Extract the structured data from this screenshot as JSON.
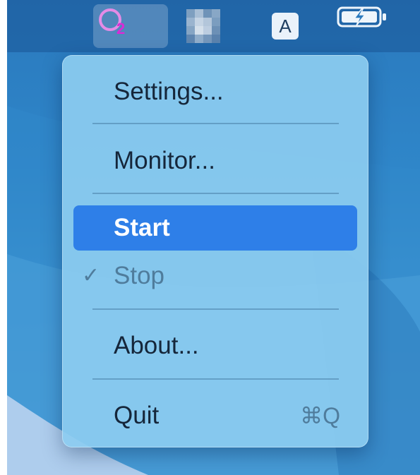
{
  "menubar": {
    "app_icon": "o2-app-icon",
    "app_icon_glyph": "O",
    "app_icon_subscript": "2",
    "blurred_icon": "pixelated-icon",
    "input_source_label": "A",
    "battery_icon": "battery-charging-icon",
    "colors": {
      "app_o": "#e58be6",
      "app_two": "#d92ad6"
    }
  },
  "menu": {
    "items": [
      {
        "label": "Settings...",
        "state": "normal"
      },
      {
        "label": "Monitor...",
        "state": "normal"
      },
      {
        "label": "Start",
        "state": "highlighted"
      },
      {
        "label": "Stop",
        "state": "disabled",
        "check": "✓"
      },
      {
        "label": "About...",
        "state": "normal"
      },
      {
        "label": "Quit",
        "state": "normal",
        "shortcut": "⌘Q"
      }
    ],
    "colors": {
      "highlight": "#2e7fe8",
      "background": "#8cccf0"
    }
  }
}
